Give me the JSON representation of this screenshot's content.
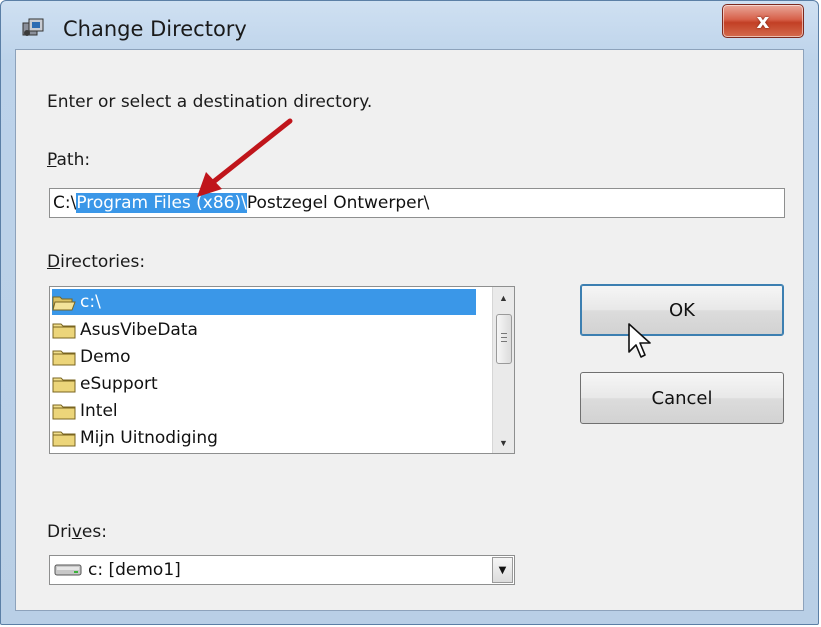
{
  "window": {
    "title": "Change Directory",
    "close_glyph": "x"
  },
  "prompt": "Enter or select a destination directory.",
  "path": {
    "label_first": "P",
    "label_rest": "ath:",
    "value_prefix": "C:\\",
    "value_selected": "Program Files (x86)\\",
    "value_suffix": "Postzegel Ontwerper\\"
  },
  "directories": {
    "label_first": "D",
    "label_rest": "irectories:",
    "items": [
      {
        "label": "c:\\",
        "icon": "open-folder-icon",
        "selected": true
      },
      {
        "label": "AsusVibeData",
        "icon": "folder-icon",
        "selected": false
      },
      {
        "label": "Demo",
        "icon": "folder-icon",
        "selected": false
      },
      {
        "label": "eSupport",
        "icon": "folder-icon",
        "selected": false
      },
      {
        "label": "Intel",
        "icon": "folder-icon",
        "selected": false
      },
      {
        "label": "Mijn Uitnodiging",
        "icon": "folder-icon",
        "selected": false
      }
    ]
  },
  "buttons": {
    "ok": "OK",
    "cancel": "Cancel"
  },
  "drives": {
    "label_pre": "Dri",
    "label_underline": "v",
    "label_post": "es:",
    "value": "c: [demo1]"
  },
  "colors": {
    "selection": "#3a97e8",
    "annotation_arrow": "#c0151b"
  }
}
